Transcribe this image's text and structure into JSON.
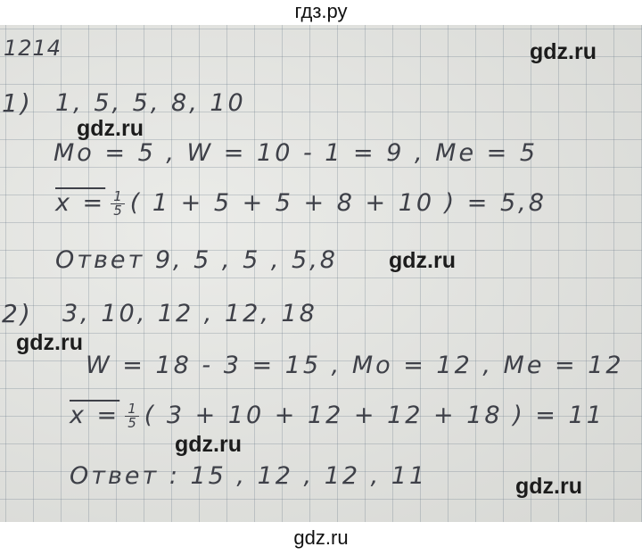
{
  "header": {
    "site_name": "гдз.ру"
  },
  "footer": {
    "site_name": "gdz.ru"
  },
  "watermark": {
    "text": "gdz.ru"
  },
  "problem_number": "1214",
  "part1": {
    "label": "1)",
    "data_values": "1, 5, 5, 8, 10",
    "stats_line": "Mo = 5 , W = 10 - 1 = 9 , Me = 5",
    "mean_lhs": "x =",
    "frac_num": "1",
    "frac_den": "5",
    "mean_rhs": "( 1 + 5 + 5 + 8 + 10 ) = 5,8",
    "answer": "Ответ 9, 5 , 5 , 5,8"
  },
  "part2": {
    "label": "2)",
    "data_values": "3, 10, 12 , 12, 18",
    "stats_line": "W = 18 - 3 = 15 , Mo = 12 , Me = 12",
    "mean_lhs": "x =",
    "frac_num": "1",
    "frac_den": "5",
    "mean_rhs": "( 3 + 10 + 12 + 12 + 18 ) = 11",
    "answer": "Ответ : 15 , 12 , 12 , 11"
  },
  "colors": {
    "paper": "#e4e5e1",
    "grid": "#6e7d8c",
    "ink": "#3e4048",
    "watermark": "#1c1c1c"
  }
}
